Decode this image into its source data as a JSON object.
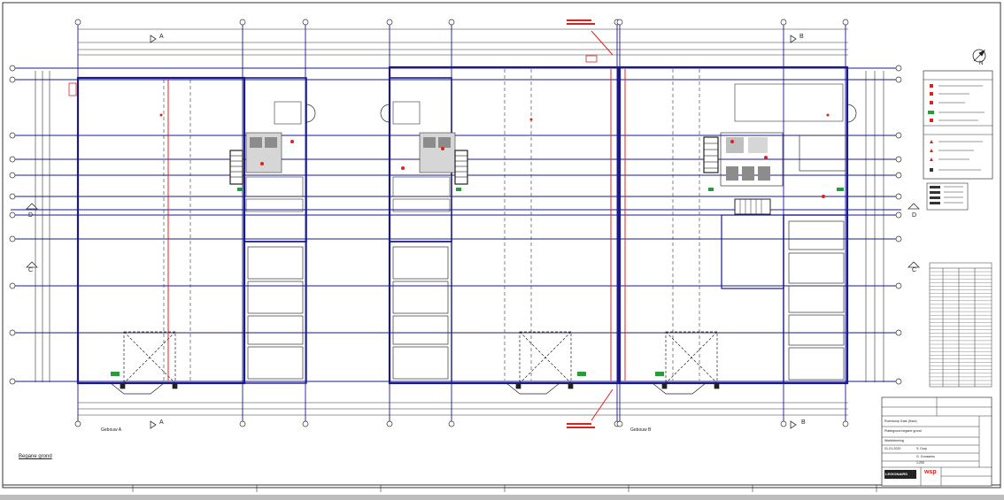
{
  "drawing": {
    "title": "Begane grond",
    "building_labels": [
      "Gebouw A",
      "Gebouw B"
    ],
    "section_marks": {
      "a": "A",
      "b": "B",
      "c": "C",
      "d": "D"
    },
    "north": "N"
  },
  "title_block": {
    "project_line": "Roerdomp Gate (Haut)",
    "drawing_line": "Plattegrond begane grond",
    "phase": "Werktekening",
    "date": "01-01-2020",
    "drawn_by": "S. Dorp",
    "checked_by": "G. Goossens",
    "scale": "1:200",
    "client_logo": "LEGIONAIRS",
    "firm_logo": "wsp"
  },
  "colors": {
    "grid_line": "#1a1a8c",
    "wall": "#1a1a8c",
    "red_annotation": "#e0201f",
    "linework": "#111111",
    "background": "#ffffff"
  },
  "legend": {
    "has_symbol_legend": true,
    "has_hatch_legend": true,
    "has_schedule_table": true
  }
}
